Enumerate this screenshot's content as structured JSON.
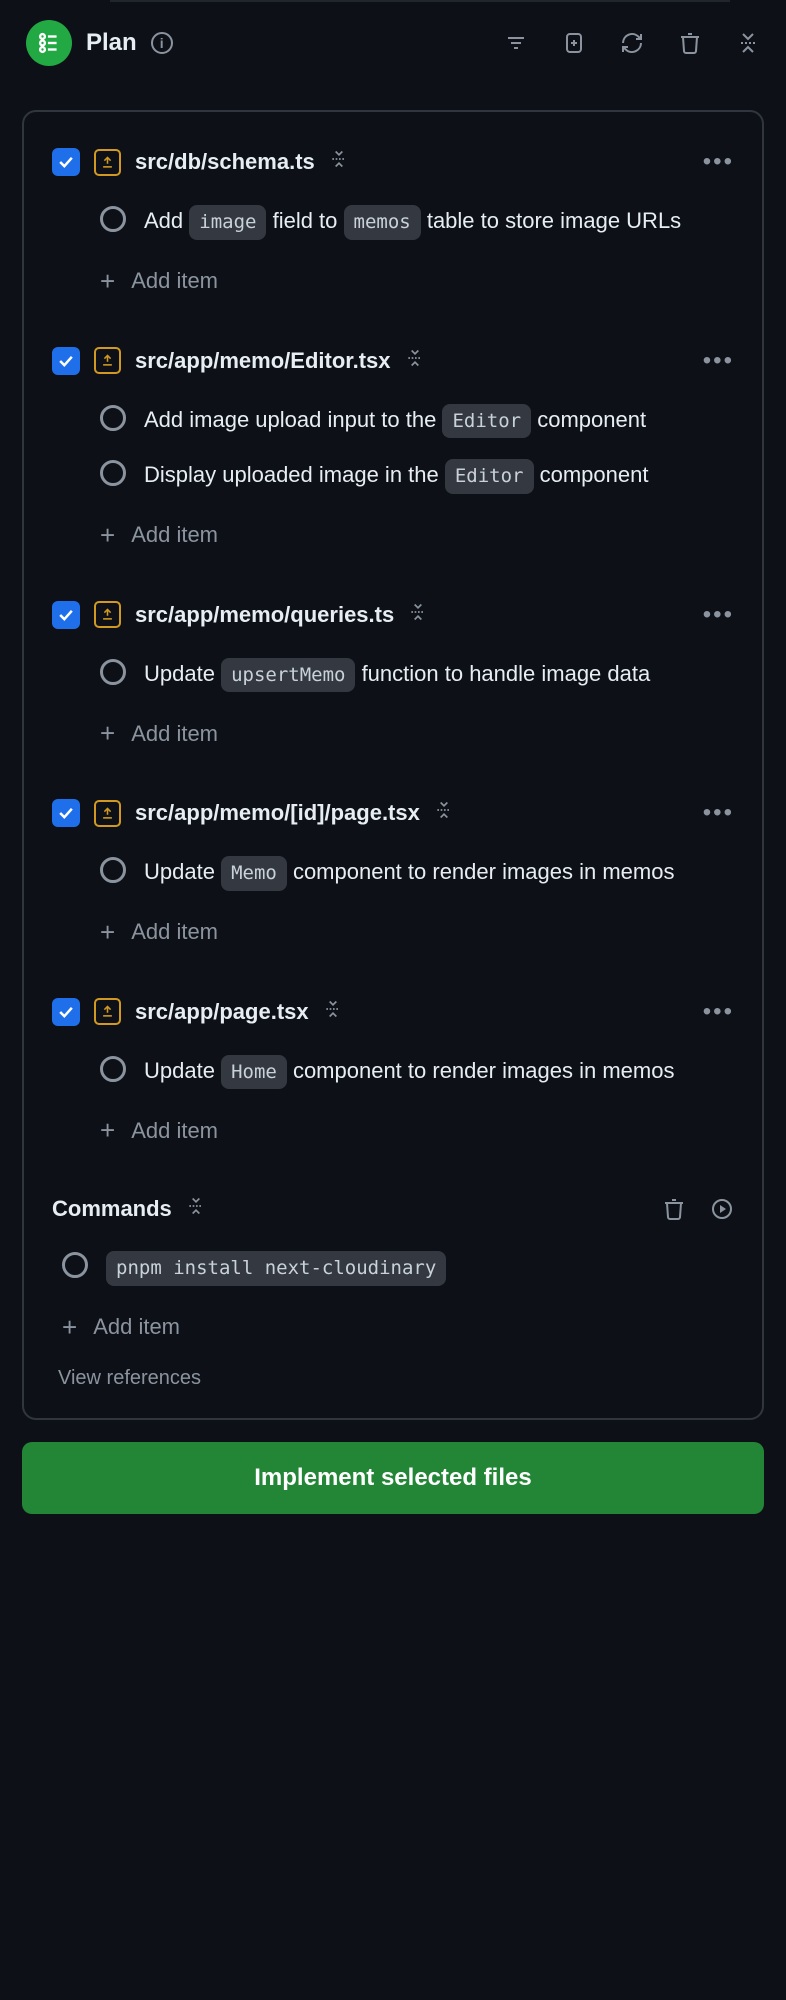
{
  "header": {
    "title": "Plan"
  },
  "files": [
    {
      "path": "src/db/schema.ts",
      "checked": true,
      "tasks": [
        {
          "parts": [
            {
              "t": "text",
              "v": "Add "
            },
            {
              "t": "code",
              "v": "image"
            },
            {
              "t": "text",
              "v": " field to "
            },
            {
              "t": "code",
              "v": "memos"
            },
            {
              "t": "text",
              "v": " table to store image URLs"
            }
          ]
        }
      ]
    },
    {
      "path": "src/app/memo/Editor.tsx",
      "checked": true,
      "tasks": [
        {
          "parts": [
            {
              "t": "text",
              "v": "Add image upload input to the "
            },
            {
              "t": "code",
              "v": "Editor"
            },
            {
              "t": "text",
              "v": " component"
            }
          ]
        },
        {
          "parts": [
            {
              "t": "text",
              "v": "Display uploaded image in the "
            },
            {
              "t": "code",
              "v": "Editor"
            },
            {
              "t": "text",
              "v": " component"
            }
          ]
        }
      ]
    },
    {
      "path": "src/app/memo/queries.ts",
      "checked": true,
      "tasks": [
        {
          "parts": [
            {
              "t": "text",
              "v": "Update "
            },
            {
              "t": "code",
              "v": "upsertMemo"
            },
            {
              "t": "text",
              "v": " function to handle image data"
            }
          ]
        }
      ]
    },
    {
      "path": "src/app/memo/[id]/page.tsx",
      "checked": true,
      "tasks": [
        {
          "parts": [
            {
              "t": "text",
              "v": "Update "
            },
            {
              "t": "code",
              "v": "Memo"
            },
            {
              "t": "text",
              "v": " component to render images in memos"
            }
          ]
        }
      ]
    },
    {
      "path": "src/app/page.tsx",
      "checked": true,
      "tasks": [
        {
          "parts": [
            {
              "t": "text",
              "v": "Update "
            },
            {
              "t": "code",
              "v": "Home"
            },
            {
              "t": "text",
              "v": " component to render images in memos"
            }
          ]
        }
      ]
    }
  ],
  "commands": {
    "title": "Commands",
    "items": [
      {
        "parts": [
          {
            "t": "code",
            "v": "pnpm install next-cloudinary"
          }
        ]
      }
    ]
  },
  "labels": {
    "add_item": "Add item",
    "view_refs": "View references",
    "implement": "Implement selected files"
  }
}
